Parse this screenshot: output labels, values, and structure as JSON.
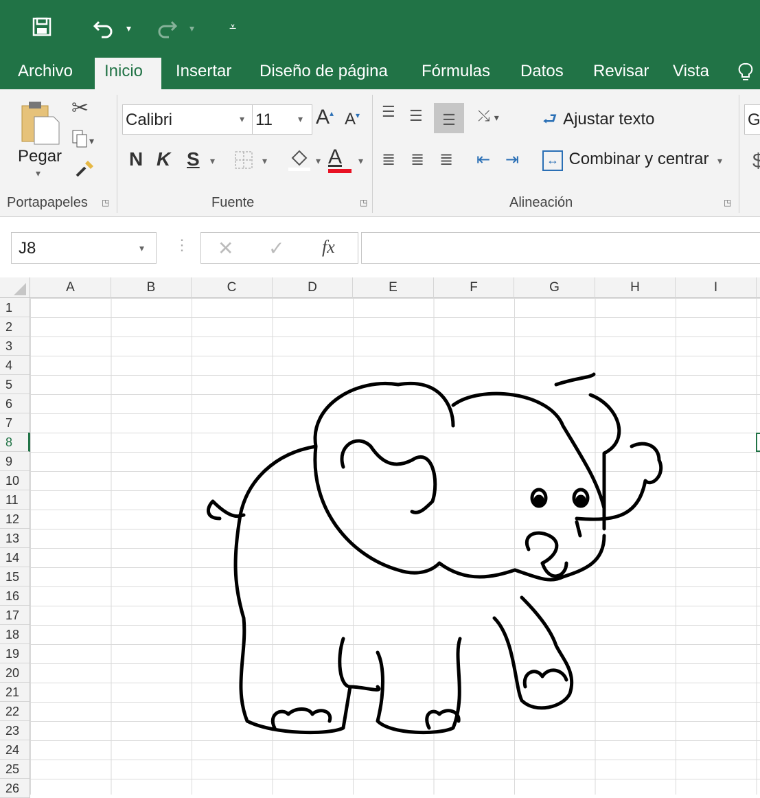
{
  "qat": {
    "save_icon": "save-icon",
    "undo_icon": "undo-icon",
    "redo_icon": "redo-icon",
    "customize_icon": "customize-icon"
  },
  "tabs": [
    {
      "label": "Archivo",
      "active": false
    },
    {
      "label": "Inicio",
      "active": true
    },
    {
      "label": "Insertar",
      "active": false
    },
    {
      "label": "Diseño de página",
      "active": false
    },
    {
      "label": "Fórmulas",
      "active": false
    },
    {
      "label": "Datos",
      "active": false
    },
    {
      "label": "Revisar",
      "active": false
    },
    {
      "label": "Vista",
      "active": false
    }
  ],
  "ribbon": {
    "clipboard": {
      "paste_label": "Pegar",
      "group_label": "Portapapeles"
    },
    "font": {
      "font_name": "Calibri",
      "font_size": "11",
      "bold": "N",
      "italic": "K",
      "underline": "S",
      "group_label": "Fuente",
      "font_color": "#e81123"
    },
    "alignment": {
      "wrap_label": "Ajustar texto",
      "merge_label": "Combinar y centrar",
      "group_label": "Alineación"
    },
    "number": {
      "format_partial": "G",
      "currency_partial": "$"
    }
  },
  "formula_bar": {
    "name_box": "J8",
    "fx_label": "fx",
    "value": ""
  },
  "columns": [
    "A",
    "B",
    "C",
    "D",
    "E",
    "F",
    "G",
    "H",
    "I"
  ],
  "rows": [
    "1",
    "2",
    "3",
    "4",
    "5",
    "6",
    "7",
    "8",
    "9",
    "10",
    "11",
    "12",
    "13",
    "14",
    "15",
    "16",
    "17",
    "18",
    "19",
    "20",
    "21",
    "22",
    "23",
    "24",
    "25",
    "26"
  ],
  "active_cell": "J8",
  "colors": {
    "brand": "#217346",
    "ribbon_bg": "#f3f3f3"
  }
}
